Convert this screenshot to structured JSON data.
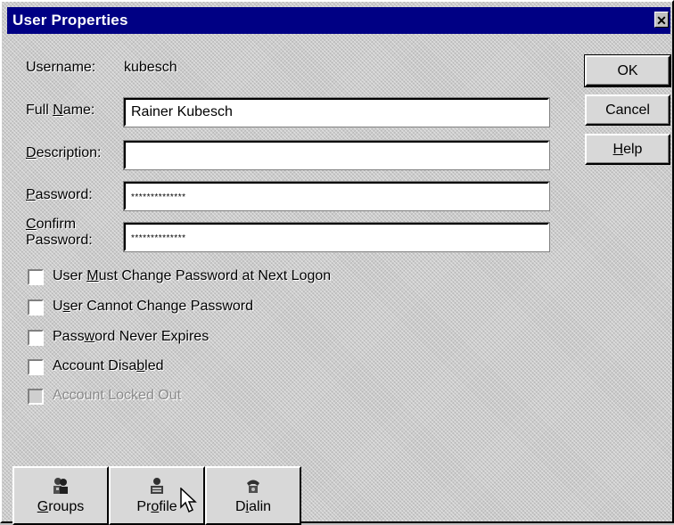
{
  "window": {
    "title": "User Properties",
    "close_glyph": "✕"
  },
  "form": {
    "username_label": "Username:",
    "username_value": "kubesch",
    "fullname_label": "Full Name:",
    "fullname_value": "Rainer Kubesch",
    "description_label": "Description:",
    "description_value": "",
    "password_label": "Password:",
    "password_value": "**************",
    "confirm_label": "Confirm Password:",
    "confirm_value": "**************"
  },
  "buttons": {
    "ok": "OK",
    "cancel": "Cancel",
    "help": "Help"
  },
  "checkboxes": [
    {
      "label": "User Must Change Password at Next Logon",
      "checked": false,
      "enabled": true
    },
    {
      "label": "User Cannot Change Password",
      "checked": false,
      "enabled": true
    },
    {
      "label": "Password Never Expires",
      "checked": false,
      "enabled": true
    },
    {
      "label": "Account Disabled",
      "checked": false,
      "enabled": true
    },
    {
      "label": "Account Locked Out",
      "checked": false,
      "enabled": false
    }
  ],
  "bottom_buttons": {
    "groups": {
      "label": "Groups",
      "icon": "groups-icon"
    },
    "profile": {
      "label": "Profile",
      "icon": "profile-icon"
    },
    "dialin": {
      "label": "Dialin",
      "icon": "dialin-icon"
    }
  }
}
